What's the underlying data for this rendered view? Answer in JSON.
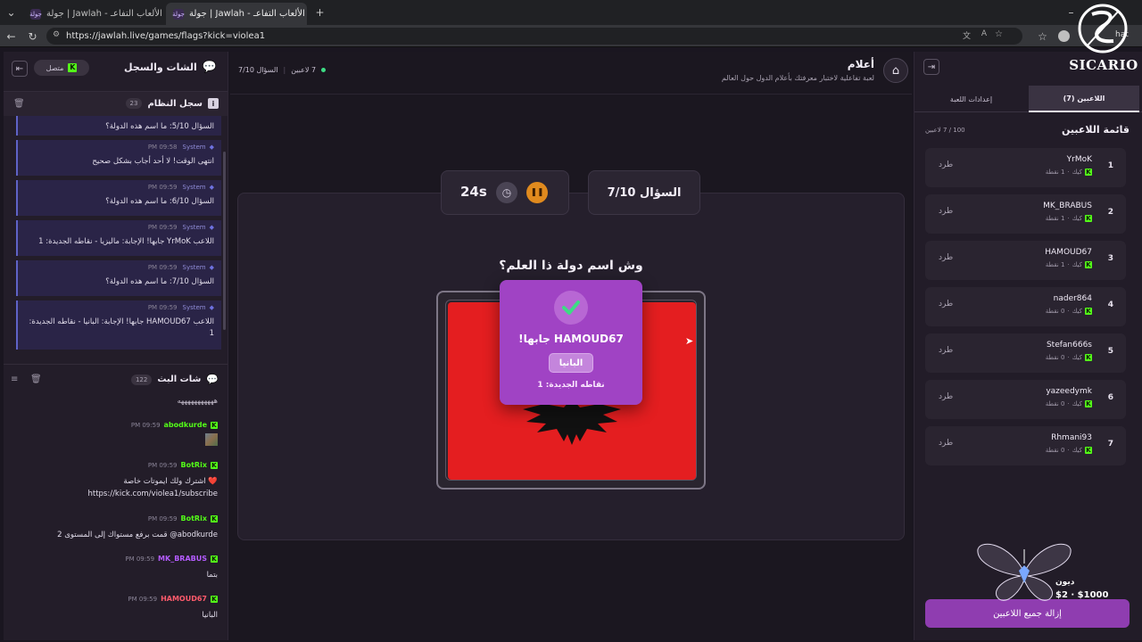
{
  "browser": {
    "tabs": [
      {
        "title": "جولة | Jawlah - منصة الألعاب التفاعـ",
        "favicon": "جولة"
      },
      {
        "title": "جولة | Jawlah - منصة الألعاب التفاعـ",
        "favicon": "جولة"
      }
    ],
    "url": "https://jawlah.live/games/flags?kick=violea1",
    "profile_label": "hat"
  },
  "chat_panel": {
    "title": "الشات والسجل",
    "status": "متصل",
    "system_log": {
      "title": "سجل النظام",
      "count": "23",
      "messages": [
        {
          "author": "",
          "time": "",
          "text": "السؤال 5/10: ما اسم هذه الدولة؟"
        },
        {
          "author": "System",
          "time": "PM 09:58",
          "text": "انتهى الوقت! لا أحد أجاب بشكل صحيح"
        },
        {
          "author": "System",
          "time": "PM 09:59",
          "text": "السؤال 6/10: ما اسم هذه الدولة؟"
        },
        {
          "author": "System",
          "time": "PM 09:59",
          "text": "اللاعب YrMoK جابها! الإجابة: ماليزيا - نقاطه الجديدة: 1"
        },
        {
          "author": "System",
          "time": "PM 09:59",
          "text": "السؤال 7/10: ما اسم هذه الدولة؟"
        },
        {
          "author": "System",
          "time": "PM 09:59",
          "text": "اللاعب HAMOUD67 جابها! الإجابة: البانيا - نقاطه الجديدة: 1"
        }
      ]
    },
    "stream_chat": {
      "title": "شات البث",
      "count": "122",
      "partial_top": "هههههههههههه",
      "messages": [
        {
          "author": "abodkurde",
          "time": "PM 09:59",
          "color": "#53fc18",
          "text": ""
        },
        {
          "author": "BotRix",
          "time": "PM 09:59",
          "color": "#53fc18",
          "text": "❤️ اشترك ولك ايموتات خاصة",
          "text2": "https://kick.com/violea1/subscribe"
        },
        {
          "author": "BotRix",
          "time": "PM 09:59",
          "color": "#53fc18",
          "text": "abodkurde@ قمت برفع مستواك إلى المستوى 2"
        },
        {
          "author": "MK_BRABUS",
          "time": "PM 09:59",
          "color": "#b45cff",
          "text": "بتما"
        },
        {
          "author": "HAMOUD67",
          "time": "PM 09:59",
          "color": "#ff5a6b",
          "text": "البانيا"
        }
      ]
    }
  },
  "main": {
    "game_title": "أعلام",
    "game_subtitle": "لعبة تفاعلية لاختبار معرفتك بأعلام الدول حول العالم",
    "players_status": "7 لاعبين",
    "question_progress": "السؤال 7/10",
    "question_card": "السؤال 7/10",
    "timer": "24s",
    "question_text": "وش اسم دولة ذا العلم؟",
    "popup": {
      "title": "HAMOUD67 جابها!",
      "answer": "البانيا",
      "points": "نقاطه الجديدة: 1"
    },
    "colors": {
      "accent": "#a043c4",
      "flag_red": "#e41e20",
      "timer_orange": "#e08a1e"
    }
  },
  "right_panel": {
    "tabs": [
      "اللاعبين (7)",
      "إعدادات اللعبة"
    ],
    "list_title": "قائمة اللاعبين",
    "capacity": "100 / 7 لاعبين",
    "kick_label": "طرد",
    "platform": "كيك",
    "players": [
      {
        "rank": "1",
        "name": "YrMoK",
        "points": "1 نقطة"
      },
      {
        "rank": "2",
        "name": "MK_BRABUS",
        "points": "1 نقطة"
      },
      {
        "rank": "3",
        "name": "HAMOUD67",
        "points": "1 نقطة"
      },
      {
        "rank": "4",
        "name": "nader864",
        "points": "0 نقطة"
      },
      {
        "rank": "5",
        "name": "Stefan666s",
        "points": "0 نقطة"
      },
      {
        "rank": "6",
        "name": "yazeedymk",
        "points": "0 نقطة"
      },
      {
        "rank": "7",
        "name": "Rhmani93",
        "points": "0 نقطة"
      }
    ],
    "remove_all": "إزالة جميع اللاعبين"
  },
  "overlay": {
    "brand": "SICARIO",
    "donor_name": "ديون",
    "donation": "$2 · $1000"
  }
}
